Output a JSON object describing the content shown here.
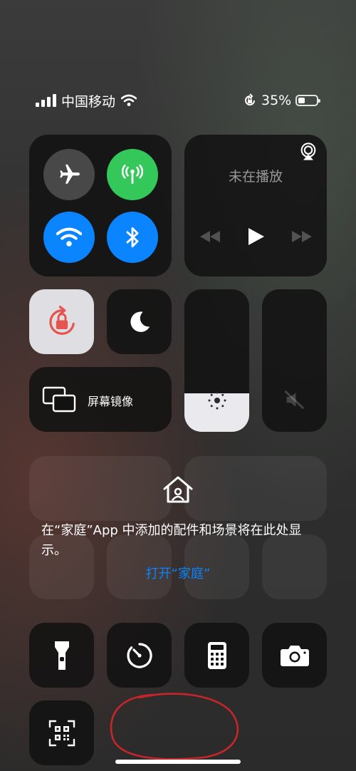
{
  "status_bar": {
    "carrier": "中国移动",
    "battery_percent": "35%",
    "battery_level": 0.35
  },
  "connectivity": {
    "airplane": {
      "icon": "airplane-icon",
      "on": false
    },
    "cellular": {
      "icon": "cellular-antenna-icon",
      "on": true,
      "color": "#34c759"
    },
    "wifi": {
      "icon": "wifi-icon",
      "on": true,
      "color": "#0a84ff"
    },
    "bluetooth": {
      "icon": "bluetooth-icon",
      "on": true,
      "color": "#0a84ff"
    }
  },
  "media": {
    "status": "未在播放"
  },
  "screen_mirroring": {
    "label": "屏幕镜像"
  },
  "brightness": {
    "level": 0.27
  },
  "home": {
    "message": "在“家庭”App 中添加的配件和场景将在此处显示。",
    "link": "打开“家庭”",
    "link_color": "#0a84ff"
  },
  "accent": {
    "rotation_lock": "#e5544f"
  }
}
